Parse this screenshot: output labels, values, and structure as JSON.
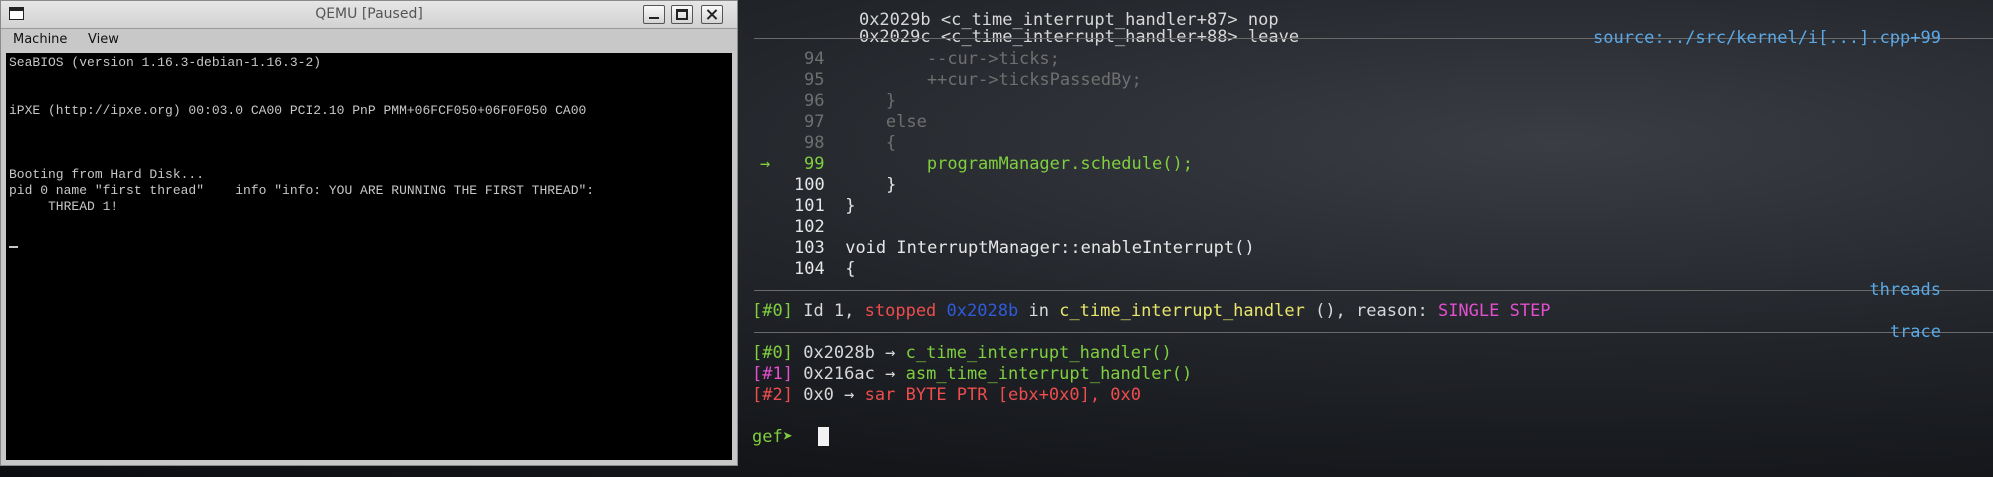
{
  "qemu": {
    "title": "QEMU [Paused]",
    "menu": [
      "Machine",
      "View"
    ],
    "screen_lines": [
      "SeaBIOS (version 1.16.3-debian-1.16.3-2)",
      "iPXE (http://ipxe.org) 00:03.0 CA00 PCI2.10 PnP PMM+06FCF050+06F0F050 CA00",
      "Booting from Hard Disk...",
      "pid 0 name \"first thread\"    info \"info: YOU ARE RUNNING THE FIRST THREAD\":",
      "     THREAD 1!"
    ]
  },
  "gdb": {
    "asm_lines": [
      {
        "addr": "0x2029b",
        "sym": "<c_time_interrupt_handler+87>",
        "op": "nop"
      },
      {
        "addr": "0x2029c",
        "sym": "<c_time_interrupt_handler+88>",
        "op": "leave"
      }
    ],
    "source_header": "source:../src/kernel/i[...].cpp+99",
    "source_lines": [
      {
        "num": "94",
        "code": "        --cur->ticks;"
      },
      {
        "num": "95",
        "code": "        ++cur->ticksPassedBy;"
      },
      {
        "num": "96",
        "code": "    }"
      },
      {
        "num": "97",
        "code": "    else"
      },
      {
        "num": "98",
        "code": "    {"
      },
      {
        "num": "99",
        "code": "        programManager.schedule();"
      },
      {
        "num": "100",
        "code": "    }"
      },
      {
        "num": "101",
        "code": "}"
      },
      {
        "num": "102",
        "code": ""
      },
      {
        "num": "103",
        "code": "void InterruptManager::enableInterrupt()"
      },
      {
        "num": "104",
        "code": "{"
      }
    ],
    "current_arrow": "→",
    "threads_header": "threads",
    "thread": {
      "idx": "[#0]",
      "id": "Id 1,",
      "state": "stopped",
      "addr": "0x2028b",
      "in": "in",
      "func": "c_time_interrupt_handler",
      "args": "(),",
      "reason_label": "reason:",
      "reason": "SINGLE STEP"
    },
    "trace_header": "trace",
    "trace": [
      {
        "idx": "[#0]",
        "addr": "0x2028b",
        "arrow": "→",
        "target": "c_time_interrupt_handler()"
      },
      {
        "idx": "[#1]",
        "addr": "0x216ac",
        "arrow": "→",
        "target": "asm_time_interrupt_handler()"
      },
      {
        "idx": "[#2]",
        "addr": "0x0",
        "arrow": "→",
        "target": "sar BYTE PTR [ebx+0x0], 0x0"
      }
    ],
    "prompt": "gef➤"
  },
  "colors": {
    "header": "#5aa9e6",
    "green": "#7fcf3f",
    "red": "#ef4d4d",
    "magenta": "#e24fcf",
    "yellow": "#e8e66a"
  }
}
